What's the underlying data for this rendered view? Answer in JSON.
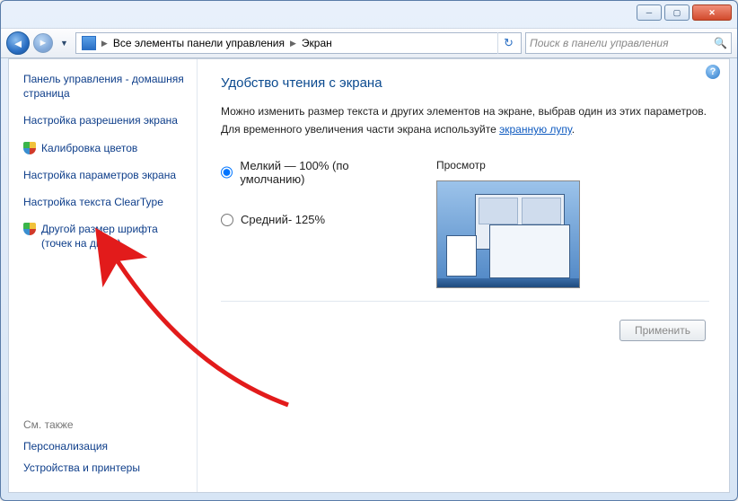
{
  "breadcrumb": {
    "root": "Все элементы панели управления",
    "leaf": "Экран"
  },
  "search": {
    "placeholder": "Поиск в панели управления"
  },
  "sidebar": {
    "items": [
      {
        "label": "Панель управления - домашняя страница"
      },
      {
        "label": "Настройка разрешения экрана"
      },
      {
        "label": "Калибровка цветов",
        "shield": true
      },
      {
        "label": "Настройка параметров экрана"
      },
      {
        "label": "Настройка текста ClearType"
      },
      {
        "label": "Другой размер шрифта (точек на дюйм)",
        "shield": true
      }
    ],
    "see_also_header": "См. также",
    "see_also": [
      {
        "label": "Персонализация"
      },
      {
        "label": "Устройства и принтеры"
      }
    ]
  },
  "main": {
    "title": "Удобство чтения с экрана",
    "desc1": "Можно изменить размер текста и других элементов на экране, выбрав один из этих параметров.",
    "desc2_pre": "Для временного увеличения части экрана используйте ",
    "desc2_link": "экранную лупу",
    "desc2_post": ".",
    "radio_small": "Мелкий — 100% (по умолчанию)",
    "radio_medium": "Средний- 125%",
    "preview_label": "Просмотр",
    "apply": "Применить"
  }
}
